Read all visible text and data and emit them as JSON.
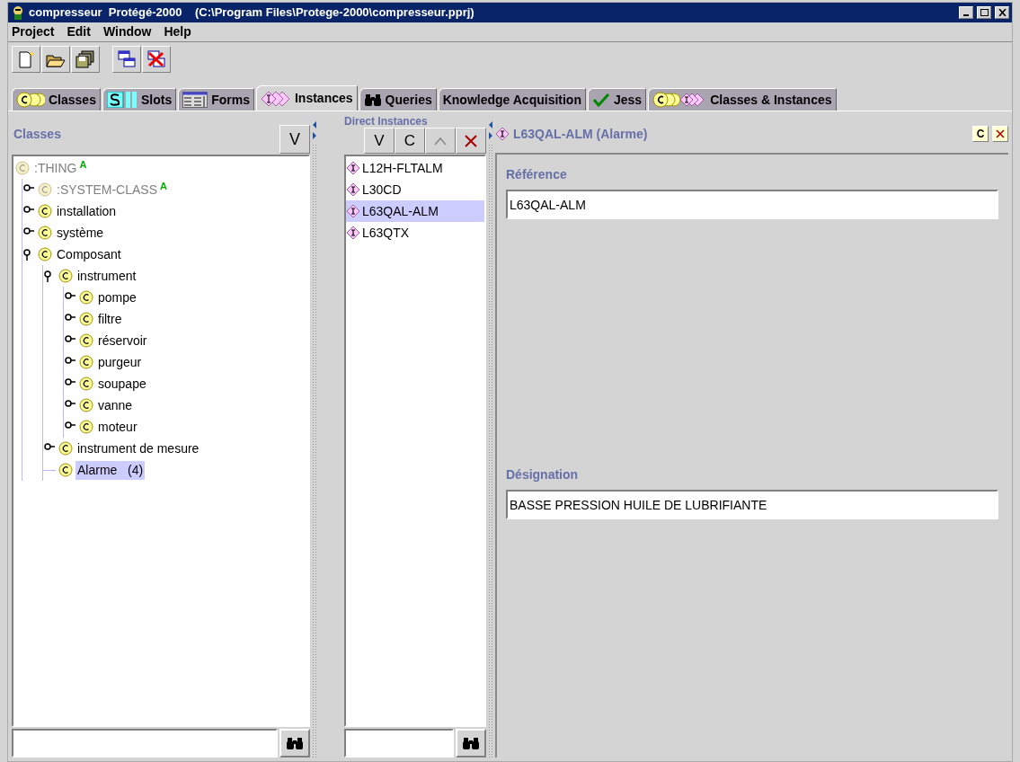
{
  "window": {
    "title": "compresseur  Protégé-2000    (C:\\Program Files\\Protege-2000\\compresseur.pprj)"
  },
  "menu": [
    "Project",
    "Edit",
    "Window",
    "Help"
  ],
  "tabs": [
    {
      "label": "Classes",
      "kind": "classes",
      "selected": false
    },
    {
      "label": "Slots",
      "kind": "slots",
      "selected": false
    },
    {
      "label": "Forms",
      "kind": "forms",
      "selected": false
    },
    {
      "label": "Instances",
      "kind": "instances",
      "selected": true
    },
    {
      "label": "Queries",
      "kind": "queries",
      "selected": false
    },
    {
      "label": "Knowledge Acquisition",
      "kind": "plain",
      "selected": false
    },
    {
      "label": "Jess",
      "kind": "jess",
      "selected": false
    },
    {
      "label": "Classes & Instances",
      "kind": "combined",
      "selected": false
    }
  ],
  "classes_panel": {
    "title": "Classes",
    "button": "V",
    "tree": [
      {
        "label": ":THING",
        "badge": "A",
        "system": true,
        "selected": false,
        "children": [
          {
            "label": ":SYSTEM-CLASS",
            "badge": "A",
            "system": true,
            "has_subclasses": true,
            "expanded": false,
            "selected": false
          },
          {
            "label": "installation",
            "system": false,
            "has_subclasses": true,
            "expanded": false,
            "selected": false
          },
          {
            "label": "système",
            "system": false,
            "has_subclasses": true,
            "expanded": false,
            "selected": false
          },
          {
            "label": "Composant",
            "system": false,
            "has_subclasses": true,
            "expanded": true,
            "selected": false,
            "children": [
              {
                "label": "instrument",
                "system": false,
                "has_subclasses": true,
                "expanded": true,
                "selected": false,
                "children": [
                  {
                    "label": "pompe",
                    "system": false,
                    "has_subclasses": true,
                    "expanded": false,
                    "selected": false
                  },
                  {
                    "label": "filtre",
                    "system": false,
                    "has_subclasses": true,
                    "expanded": false,
                    "selected": false
                  },
                  {
                    "label": "réservoir",
                    "system": false,
                    "has_subclasses": true,
                    "expanded": false,
                    "selected": false
                  },
                  {
                    "label": "purgeur",
                    "system": false,
                    "has_subclasses": true,
                    "expanded": false,
                    "selected": false
                  },
                  {
                    "label": "soupape",
                    "system": false,
                    "has_subclasses": true,
                    "expanded": false,
                    "selected": false
                  },
                  {
                    "label": "vanne",
                    "system": false,
                    "has_subclasses": true,
                    "expanded": false,
                    "selected": false
                  },
                  {
                    "label": "moteur",
                    "system": false,
                    "has_subclasses": true,
                    "expanded": false,
                    "selected": false
                  }
                ]
              },
              {
                "label": "instrument de mesure",
                "system": false,
                "has_subclasses": true,
                "expanded": false,
                "selected": false
              },
              {
                "label": "Alarme   (4)",
                "system": false,
                "has_subclasses": false,
                "selected": true
              }
            ]
          }
        ]
      }
    ]
  },
  "instances_panel": {
    "title": "Direct Instances",
    "buttons": [
      "V",
      "C"
    ],
    "items": [
      {
        "label": "L12H-FLTALM",
        "selected": false
      },
      {
        "label": "L30CD",
        "selected": false
      },
      {
        "label": "L63QAL-ALM",
        "selected": true
      },
      {
        "label": "L63QTX",
        "selected": false
      }
    ]
  },
  "form_panel": {
    "title": "L63QAL-ALM (Alarme)",
    "button": "C",
    "fields": [
      {
        "label": "Référence",
        "value": "L63QAL-ALM"
      },
      {
        "label": "Désignation",
        "value": "BASSE PRESSION HUILE DE LUBRIFIANTE"
      }
    ]
  }
}
